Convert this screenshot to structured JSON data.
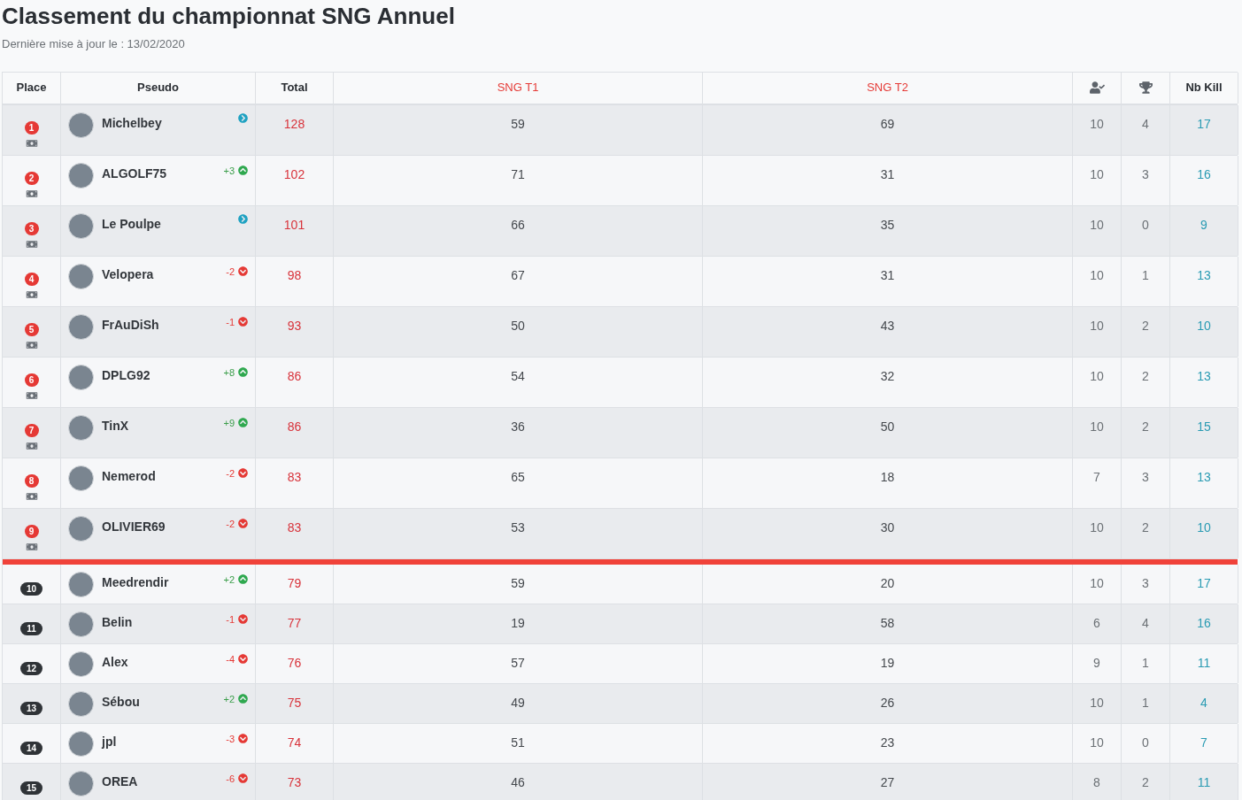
{
  "title": "Classement du championnat SNG Annuel",
  "subtitle": "Dernière mise à jour le : 13/02/2020",
  "columns": [
    "Place",
    "Pseudo",
    "Total",
    "SNG T1",
    "SNG T2",
    "Nb Kill"
  ],
  "rows": [
    {
      "place": "1",
      "qualified": true,
      "name": "Michelbey",
      "trend": {
        "kind": "same"
      },
      "total": "128",
      "t1": "59",
      "t2": "69",
      "played": "10",
      "wins": "4",
      "kills": "17"
    },
    {
      "place": "2",
      "qualified": true,
      "name": "ALGOLF75",
      "trend": {
        "kind": "up",
        "delta": "+3"
      },
      "total": "102",
      "t1": "71",
      "t2": "31",
      "played": "10",
      "wins": "3",
      "kills": "16"
    },
    {
      "place": "3",
      "qualified": true,
      "name": "Le Poulpe",
      "trend": {
        "kind": "same"
      },
      "total": "101",
      "t1": "66",
      "t2": "35",
      "played": "10",
      "wins": "0",
      "kills": "9"
    },
    {
      "place": "4",
      "qualified": true,
      "name": "Velopera",
      "trend": {
        "kind": "down",
        "delta": "-2"
      },
      "total": "98",
      "t1": "67",
      "t2": "31",
      "played": "10",
      "wins": "1",
      "kills": "13"
    },
    {
      "place": "5",
      "qualified": true,
      "name": "FrAuDiSh",
      "trend": {
        "kind": "down",
        "delta": "-1"
      },
      "total": "93",
      "t1": "50",
      "t2": "43",
      "played": "10",
      "wins": "2",
      "kills": "10"
    },
    {
      "place": "6",
      "qualified": true,
      "name": "DPLG92",
      "trend": {
        "kind": "up",
        "delta": "+8"
      },
      "total": "86",
      "t1": "54",
      "t2": "32",
      "played": "10",
      "wins": "2",
      "kills": "13"
    },
    {
      "place": "7",
      "qualified": true,
      "name": "TinX",
      "trend": {
        "kind": "up",
        "delta": "+9"
      },
      "total": "86",
      "t1": "36",
      "t2": "50",
      "played": "10",
      "wins": "2",
      "kills": "15"
    },
    {
      "place": "8",
      "qualified": true,
      "name": "Nemerod",
      "trend": {
        "kind": "down",
        "delta": "-2"
      },
      "total": "83",
      "t1": "65",
      "t2": "18",
      "played": "7",
      "wins": "3",
      "kills": "13"
    },
    {
      "place": "9",
      "qualified": true,
      "name": "OLIVIER69",
      "trend": {
        "kind": "down",
        "delta": "-2"
      },
      "total": "83",
      "t1": "53",
      "t2": "30",
      "played": "10",
      "wins": "2",
      "kills": "10"
    },
    {
      "place": "10",
      "qualified": false,
      "name": "Meedrendir",
      "trend": {
        "kind": "up",
        "delta": "+2"
      },
      "total": "79",
      "t1": "59",
      "t2": "20",
      "played": "10",
      "wins": "3",
      "kills": "17"
    },
    {
      "place": "11",
      "qualified": false,
      "name": "Belin",
      "trend": {
        "kind": "down",
        "delta": "-1"
      },
      "total": "77",
      "t1": "19",
      "t2": "58",
      "played": "6",
      "wins": "4",
      "kills": "16"
    },
    {
      "place": "12",
      "qualified": false,
      "name": "Alex",
      "trend": {
        "kind": "down",
        "delta": "-4"
      },
      "total": "76",
      "t1": "57",
      "t2": "19",
      "played": "9",
      "wins": "1",
      "kills": "11"
    },
    {
      "place": "13",
      "qualified": false,
      "name": "Sébou",
      "trend": {
        "kind": "up",
        "delta": "+2"
      },
      "total": "75",
      "t1": "49",
      "t2": "26",
      "played": "10",
      "wins": "1",
      "kills": "4"
    },
    {
      "place": "14",
      "qualified": false,
      "name": "jpl",
      "trend": {
        "kind": "down",
        "delta": "-3"
      },
      "total": "74",
      "t1": "51",
      "t2": "23",
      "played": "10",
      "wins": "0",
      "kills": "7"
    },
    {
      "place": "15",
      "qualified": false,
      "name": "OREA",
      "trend": {
        "kind": "down",
        "delta": "-6"
      },
      "total": "73",
      "t1": "46",
      "t2": "27",
      "played": "8",
      "wins": "2",
      "kills": "11"
    }
  ]
}
